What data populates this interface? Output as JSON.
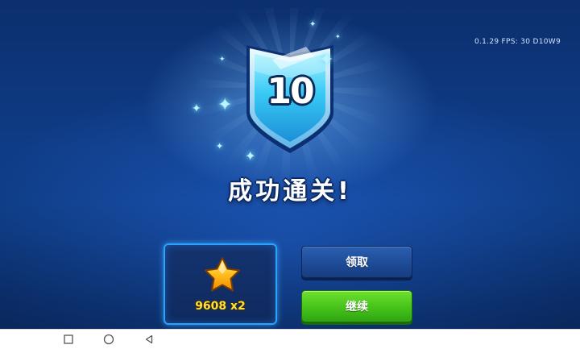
{
  "hud": {
    "version_fps": "0.1.29  FPS:  30  D10W9"
  },
  "badge": {
    "level": "10"
  },
  "title": "成功通关!",
  "reward": {
    "amount_text": "9608 x2",
    "icon": "star-icon"
  },
  "buttons": {
    "claim": "领取",
    "continue": "继续"
  },
  "navbar": {
    "icons": [
      "recent-apps-icon",
      "home-icon",
      "back-icon"
    ]
  },
  "colors": {
    "accent_blue": "#2aa3ff",
    "continue_green": "#46c21a",
    "reward_yellow": "#ffe040",
    "badge_cyan": "#36c8f5"
  }
}
